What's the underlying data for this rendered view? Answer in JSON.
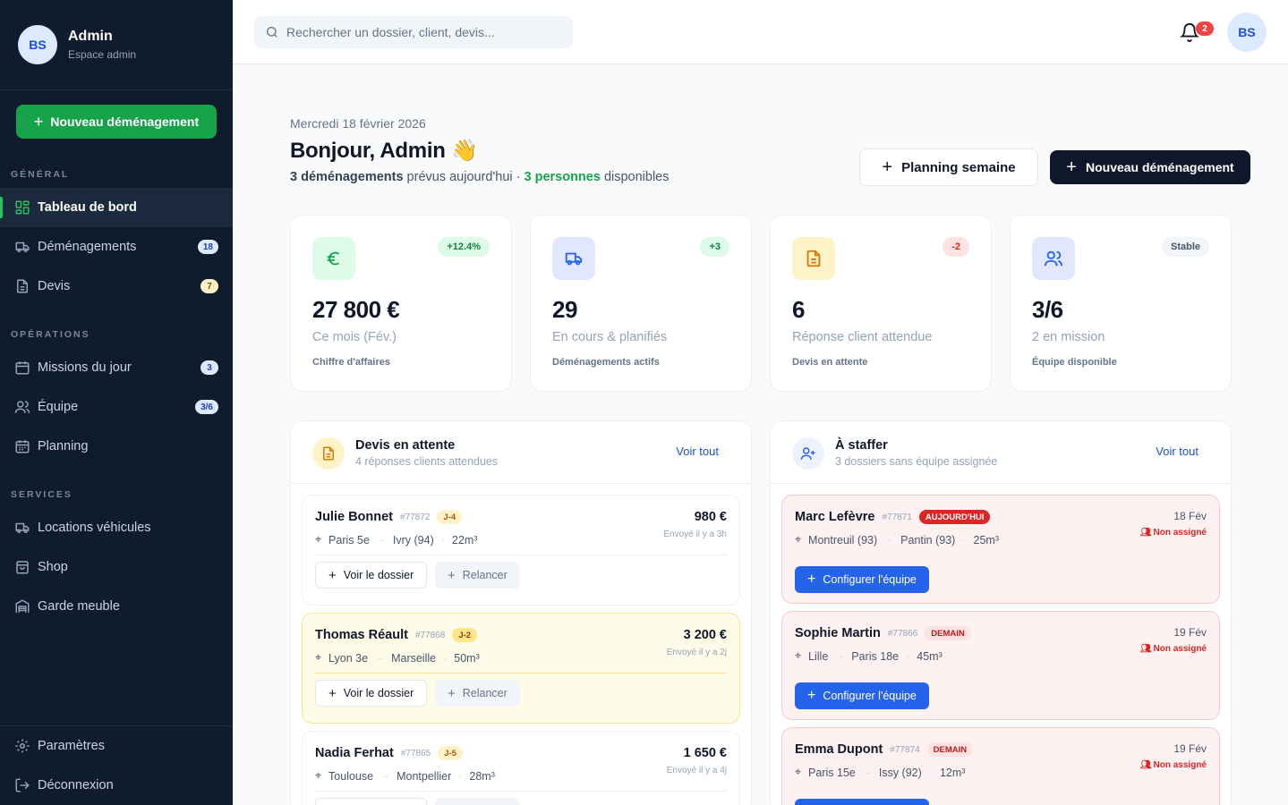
{
  "sidebar": {
    "avatar_initials": "BS",
    "user_name": "Admin",
    "user_role": "Espace admin",
    "cta_label": "Nouveau déménagement",
    "sections": {
      "general": "GÉNÉRAL",
      "operations": "OPÉRATIONS",
      "services": "SERVICES"
    },
    "items": [
      {
        "label": "Tableau de bord",
        "icon": "grid-icon",
        "active": true
      },
      {
        "label": "Déménagements",
        "icon": "truck-icon",
        "badge": "18"
      },
      {
        "label": "Devis",
        "icon": "document-icon",
        "badge": "7"
      },
      {
        "label": "Missions du jour",
        "icon": "calendar-icon",
        "badge": "3"
      },
      {
        "label": "Équipe",
        "icon": "users-icon",
        "badge": "3/6"
      },
      {
        "label": "Planning",
        "icon": "calendar-grid-icon"
      },
      {
        "label": "Locations véhicules",
        "icon": "truck-icon"
      },
      {
        "label": "Shop",
        "icon": "shopping-bag-icon"
      },
      {
        "label": "Garde meuble",
        "icon": "warehouse-icon"
      },
      {
        "label": "Paramètres",
        "icon": "gear-icon"
      },
      {
        "label": "Déconnexion",
        "icon": "logout-icon"
      }
    ]
  },
  "topbar": {
    "search_placeholder": "Rechercher un dossier, client, devis...",
    "notification_count": "2",
    "avatar_initials": "BS"
  },
  "header": {
    "date": "Mercredi 18 février 2026",
    "greeting": "Bonjour, Admin",
    "greeting_emoji": "👋",
    "summary_bold": "3 déménagements",
    "summary_mid": " prévus aujourd'hui · ",
    "summary_green": "3 personnes",
    "summary_end": " disponibles",
    "btn_planning": "Planning semaine",
    "btn_new": "Nouveau déménagement"
  },
  "stats": [
    {
      "icon": "euro-icon",
      "trend": "+12.4%",
      "value": "27 800 €",
      "desc": "Ce mois (Fév.)",
      "label": "Chiffre d'affaires"
    },
    {
      "icon": "truck-icon",
      "trend": "+3",
      "value": "29",
      "desc": "En cours & planifiés",
      "label": "Déménagements actifs"
    },
    {
      "icon": "document-icon",
      "trend": "-2",
      "value": "6",
      "desc": "Réponse client attendue",
      "label": "Devis en attente"
    },
    {
      "icon": "users-icon",
      "trend": "Stable",
      "value": "3/6",
      "desc": "2 en mission",
      "label": "Équipe disponible"
    }
  ],
  "quotes_panel": {
    "title": "Devis en attente",
    "subtitle": "4 réponses clients attendues",
    "see_all": "Voir tout",
    "btn_view": "Voir le dossier",
    "btn_remind": "Relancer",
    "items": [
      {
        "name": "Julie Bonnet",
        "ref": "#77872",
        "tag": "J-4",
        "from": "Paris 5e",
        "to": "Ivry (94)",
        "volume": "22m³",
        "amount": "980 €",
        "sent": "Envoyé il y a 3h"
      },
      {
        "name": "Thomas Réault",
        "ref": "#77868",
        "tag": "J-2",
        "from": "Lyon 3e",
        "to": "Marseille",
        "volume": "50m³",
        "amount": "3 200 €",
        "sent": "Envoyé il y a 2j"
      },
      {
        "name": "Nadia Ferhat",
        "ref": "#77865",
        "tag": "J-5",
        "from": "Toulouse",
        "to": "Montpellier",
        "volume": "28m³",
        "amount": "1 650 €",
        "sent": "Envoyé il y a 4j"
      }
    ]
  },
  "staff_panel": {
    "title": "À staffer",
    "subtitle": "3 dossiers sans équipe assignée",
    "see_all": "Voir tout",
    "btn_configure": "Configurer l'équipe",
    "unassigned": "Non assigné",
    "items": [
      {
        "name": "Marc Lefèvre",
        "ref": "#77871",
        "tag": "AUJOURD'HUI",
        "from": "Montreuil (93)",
        "to": "Pantin (93)",
        "volume": "25m³",
        "date": "18 Fév"
      },
      {
        "name": "Sophie Martin",
        "ref": "#77866",
        "tag": "DEMAIN",
        "from": "Lille",
        "to": "Paris 18e",
        "volume": "45m³",
        "date": "19 Fév"
      },
      {
        "name": "Emma Dupont",
        "ref": "#77874",
        "tag": "DEMAIN",
        "from": "Paris 15e",
        "to": "Issy (92)",
        "volume": "12m³",
        "date": "19 Fév"
      }
    ]
  },
  "colors": {
    "sidebar_bg": "#0f1c2e",
    "green": "#16a34a",
    "blue": "#2563eb",
    "red": "#dc2626",
    "amber": "#b45309"
  }
}
